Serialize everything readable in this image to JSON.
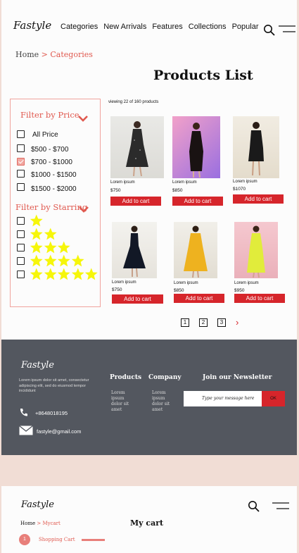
{
  "header": {
    "logo": "Fastyle",
    "nav": [
      "Categories",
      "New Arrivals",
      "Features",
      "Collections",
      "Popular"
    ]
  },
  "breadcrumb": {
    "home": "Home",
    "sep": ">",
    "current": "Categories"
  },
  "page_title": "Products List",
  "filter": {
    "price_heading": "Filter by Price",
    "price_options": [
      {
        "label": "All Price",
        "checked": false
      },
      {
        "label": "$500 - $700",
        "checked": false
      },
      {
        "label": "$700 - $1000",
        "checked": true
      },
      {
        "label": "$1000 - $1500",
        "checked": false
      },
      {
        "label": "$1500 - $2000",
        "checked": false
      }
    ],
    "rating_heading": "Filter by Starring",
    "rating_options": [
      1,
      2,
      3,
      4,
      5
    ]
  },
  "viewing_text": "viewing 22 of 160 products",
  "products": [
    {
      "name": "Lorem ipsum",
      "price": "$750",
      "button": "Add to cart"
    },
    {
      "name": "Lorem ipsum",
      "price": "$850",
      "button": "Add to cart"
    },
    {
      "name": "Lorem ipsum",
      "price": "$1070",
      "button": "Add to cart"
    },
    {
      "name": "Lorem ipsum",
      "price": "$750",
      "button": "Add to cart"
    },
    {
      "name": "Lorem ipsum",
      "price": "$850",
      "button": "Add to cart"
    },
    {
      "name": "Lorem ipsum",
      "price": "$950",
      "button": "Add to cart"
    }
  ],
  "pagination": {
    "pages": [
      "1",
      "2",
      "3"
    ],
    "next": "›"
  },
  "footer": {
    "logo": "Fastyle",
    "about": "Lorem ipsum dolor sit amet, consectetur adipiscing elit, sed do eiusmod tempor incididunt",
    "phone": "+8648018195",
    "email": "fastyle@gmail.com",
    "products_heading": "Products",
    "products_list": "Lorem ipsum dolor sit amet",
    "company_heading": "Company",
    "company_list": "Lorem ipsum dolor sit amet",
    "newsletter_heading": "Join our Newsletter",
    "newsletter_placeholder": "Type your message here",
    "newsletter_button": "OK"
  },
  "cart_page": {
    "logo": "Fastyle",
    "breadcrumb_home": "Home",
    "breadcrumb_sep": ">",
    "breadcrumb_current": "Mycart",
    "title": "My cart",
    "step_number": "1",
    "step_label": "Shopping Cart"
  },
  "colors": {
    "accent": "#d6252b",
    "accent_soft": "#e0594f",
    "footer_bg": "#53575f",
    "star": "#f6f60a",
    "page_bg": "#f1ddd5"
  }
}
